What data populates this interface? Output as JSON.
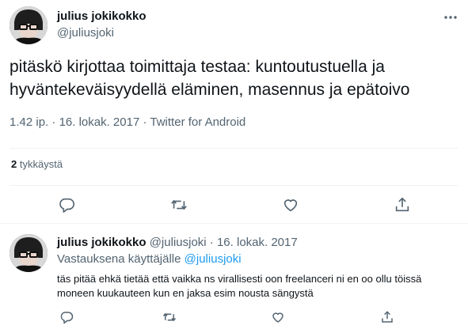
{
  "tweet": {
    "author": {
      "name": "julius jokikokko",
      "handle": "@juliusjoki"
    },
    "text": "pitäskö kirjottaa toimittaja testaa: kuntoutustuella ja hyväntekeväisyydellä eläminen, masennus ja epätoivo",
    "meta": {
      "time": "1.42 ip.",
      "date": "16. lokak. 2017",
      "source": "Twitter for Android",
      "separator": "·"
    },
    "likes": {
      "count": "2",
      "label": "tykkäystä"
    },
    "icons": {
      "more": "more-dots-icon",
      "reply": "reply-icon",
      "retweet": "retweet-icon",
      "like": "like-icon",
      "share": "share-icon"
    }
  },
  "reply": {
    "author": {
      "name": "julius jokikokko",
      "handle": "@juliusjoki"
    },
    "separator": "·",
    "date": "16. lokak. 2017",
    "replying_prefix": "Vastauksena käyttäjälle",
    "replying_to": "@juliusjoki",
    "text": "täs pitää ehkä tietää että vaikka ns virallisesti oon freelanceri ni en oo ollu töissä moneen kuukauteen kun en jaksa esim nousta sängystä"
  },
  "colors": {
    "text": "#0f1419",
    "secondary": "#536471",
    "link": "#1d9bf0",
    "divider": "#eff3f4"
  }
}
